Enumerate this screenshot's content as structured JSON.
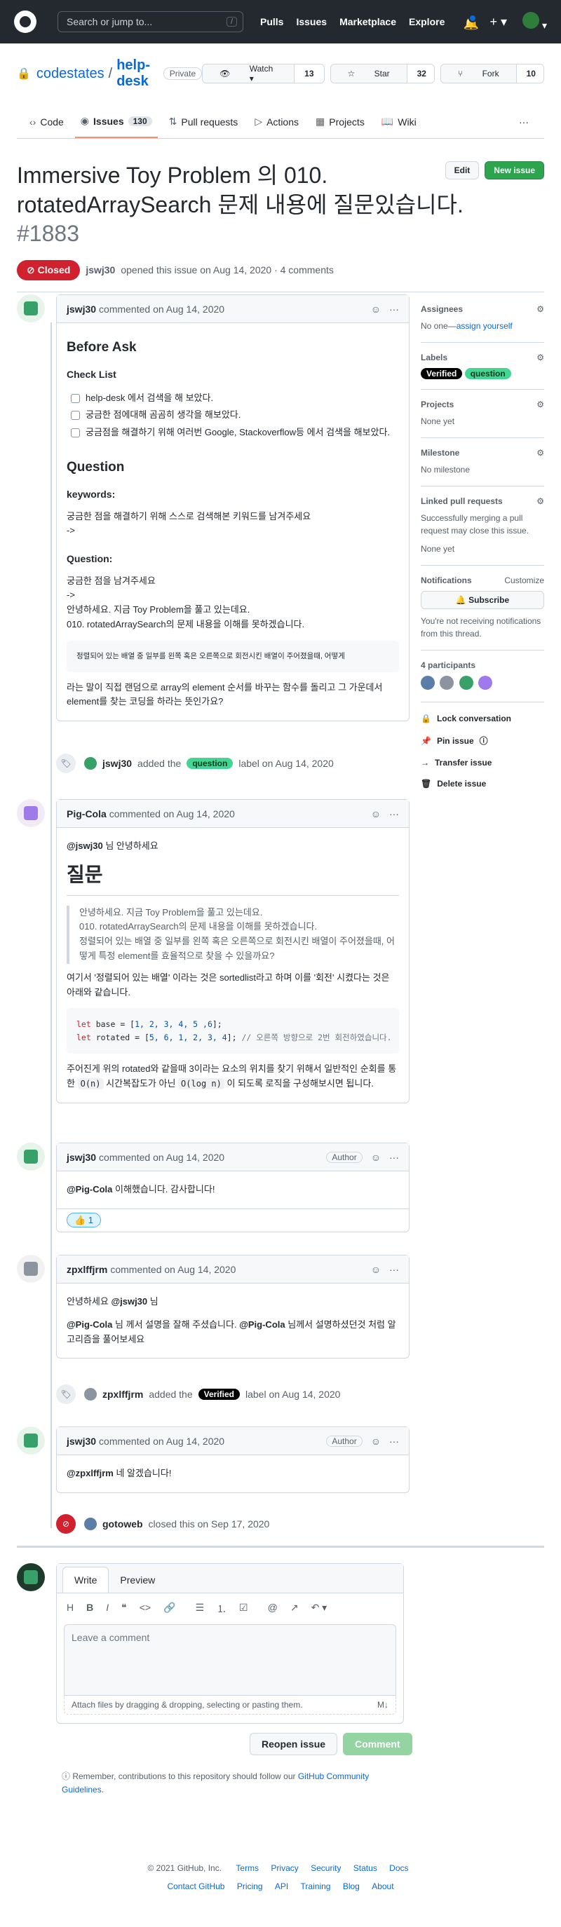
{
  "header": {
    "search_placeholder": "Search or jump to...",
    "search_key": "/",
    "nav": [
      "Pulls",
      "Issues",
      "Marketplace",
      "Explore"
    ],
    "plus": "+ ▾",
    "avatar_caret": "▾"
  },
  "repo": {
    "owner": "codestates",
    "sep": "/",
    "name": "help-desk",
    "visibility": "Private",
    "watch_label": "Watch ▾",
    "watch_count": "13",
    "star_label": "Star",
    "star_count": "32",
    "fork_label": "Fork",
    "fork_count": "10"
  },
  "tabs": {
    "code": "Code",
    "issues": "Issues",
    "issues_count": "130",
    "pulls": "Pull requests",
    "actions": "Actions",
    "projects": "Projects",
    "wiki": "Wiki",
    "more": "···"
  },
  "issue": {
    "title": "Immersive Toy Problem 의 010. rotatedArraySearch 문제 내용에 질문있습니다.",
    "number": "#1883",
    "edit": "Edit",
    "new_issue": "New issue",
    "state": "Closed",
    "author": "jswj30",
    "opened_text": "opened this issue on Aug 14, 2020 · 4 comments"
  },
  "comment1": {
    "author": "jswj30",
    "date": "commented on Aug 14, 2020",
    "h_before": "Before Ask",
    "check_list": "Check List",
    "checks": [
      "help-desk 에서 검색을 해 보았다.",
      "궁금한 점에대해 곰곰히 생각을 해보았다.",
      "궁금점을 해결하기 위해 여러번 Google, Stackoverflow등 에서 검색을 해보았다."
    ],
    "h_question": "Question",
    "keywords": "keywords:",
    "kw_text": "궁금한 점을 해결하기 위해 스스로 검색해본 키워드를 남겨주세요",
    "arrow1": "->",
    "question": "Question:",
    "q_text": "궁금한 점을 남겨주세요",
    "arrow2": "->",
    "line1": "안녕하세요. 지금 Toy Problem을 풀고 있는데요.",
    "line2": "010. rotatedArraySearch의 문제 내용을 이해를 못하겠습니다.",
    "code": "정렬되어 있는 배열 중 일부를 왼쪽 혹은 오른쪽으로 회전시킨 배열이 주어졌을때, 어떻게",
    "last": "라는 말이 직접 랜덤으로 array의 element 순서를 바꾸는 함수를 돌리고 그 가운데서 element를 찾는 코딩을 하라는 뜻인가요?"
  },
  "event1": {
    "actor": "jswj30",
    "text_a": "added the",
    "label": "question",
    "text_b": "label on Aug 14, 2020"
  },
  "comment2": {
    "author": "Pig-Cola",
    "date": "commented on Aug 14, 2020",
    "mention": "@jswj30",
    "greet": "님 안녕하세요",
    "heading": "질문",
    "quote1": "안녕하세요. 지금 Toy Problem을 풀고 있는데요.",
    "quote2": "010. rotatedArraySearch의 문제 내용을 이해를 못하겠습니다.",
    "quote3": "정렬되어 있는 배열 중 일부를 왼쪽 혹은 오른쪽으로 회전시킨 배열이 주어졌을때, 어떻게 특정 element를 효율적으로 찾을 수 있을까요?",
    "para1": "여기서 '정렬되어 있는 배열' 이라는 것은 sortedlist라고 하며 이를 '회전' 시켰다는 것은 아래와 같습니다.",
    "code_let": "let",
    "code_l1a": " base = [",
    "code_l1n": "1, 2, 3, 4, 5 ,6",
    "code_l1b": "];",
    "code_l2a": " rotated = [",
    "code_l2n": "5, 6, 1, 2, 3, 4",
    "code_l2b": "]; ",
    "code_cm": "// 오른쪽 방향으로 2번 회전하였습니다.",
    "para2a": "주어진게 위의 rotated와 같을때 3이라는 요소의 위치를 찾기 위해서 일반적인 순회를 통한",
    "on": "O(n)",
    "para2b": "시간복잡도가 아닌",
    "ologn": "O(log n)",
    "para2c": "이 되도록 로직을 구성해보시면 됩니다."
  },
  "comment3": {
    "author": "jswj30",
    "date": "commented on Aug 14, 2020",
    "badge": "Author",
    "mention": "@Pig-Cola",
    "text": "이해했습니다. 감사합니다!",
    "reaction": "👍 1"
  },
  "comment4": {
    "author": "zpxlffjrm",
    "date": "commented on Aug 14, 2020",
    "greet_a": "안녕하세요",
    "mention": "@jswj30",
    "greet_b": "님",
    "m1": "@Pig-Cola",
    "t1": "님 께서 설명을 잘해 주셨습니다.",
    "m2": "@Pig-Cola",
    "t2": "님께서 설명하셨던것 처럼 알고리즘을 풀어보세요"
  },
  "event2": {
    "actor": "zpxlffjrm",
    "text_a": "added the",
    "label": "Verified",
    "text_b": "label on Aug 14, 2020"
  },
  "comment5": {
    "author": "jswj30",
    "date": "commented on Aug 14, 2020",
    "badge": "Author",
    "mention": "@zpxlffjrm",
    "text": "네 알겠습니다!"
  },
  "event3": {
    "actor": "gotoweb",
    "text": "closed this on Sep 17, 2020"
  },
  "sidebar": {
    "assignees": "Assignees",
    "assignees_val": "No one—",
    "assign_self": "assign yourself",
    "labels": "Labels",
    "label1": "Verified",
    "label2": "question",
    "projects": "Projects",
    "projects_val": "None yet",
    "milestone": "Milestone",
    "milestone_val": "No milestone",
    "linked": "Linked pull requests",
    "linked_text": "Successfully merging a pull request may close this issue.",
    "linked_val": "None yet",
    "notifications": "Notifications",
    "customize": "Customize",
    "subscribe": "🔔 Subscribe",
    "notif_text": "You're not receiving notifications from this thread.",
    "participants": "4 participants",
    "lock": "Lock conversation",
    "pin": "Pin issue",
    "transfer": "Transfer issue",
    "delete": "Delete issue"
  },
  "compose": {
    "write": "Write",
    "preview": "Preview",
    "tools": [
      "H",
      "B",
      "I",
      "❝",
      "<>",
      "🔗",
      "☰",
      "⒈",
      "☑",
      "@",
      "↗",
      "↶ ▾"
    ],
    "placeholder": "Leave a comment",
    "attach": "Attach files by dragging & dropping, selecting or pasting them.",
    "md": "M↓",
    "reopen": "Reopen issue",
    "comment": "Comment",
    "note_a": "Remember, contributions to this repository should follow our",
    "note_link": "GitHub Community Guidelines",
    "note_b": "."
  },
  "footer": {
    "copy": "© 2021 GitHub, Inc.",
    "row1": [
      "Terms",
      "Privacy",
      "Security",
      "Status",
      "Docs"
    ],
    "row2": [
      "Contact GitHub",
      "Pricing",
      "API",
      "Training",
      "Blog",
      "About"
    ]
  }
}
